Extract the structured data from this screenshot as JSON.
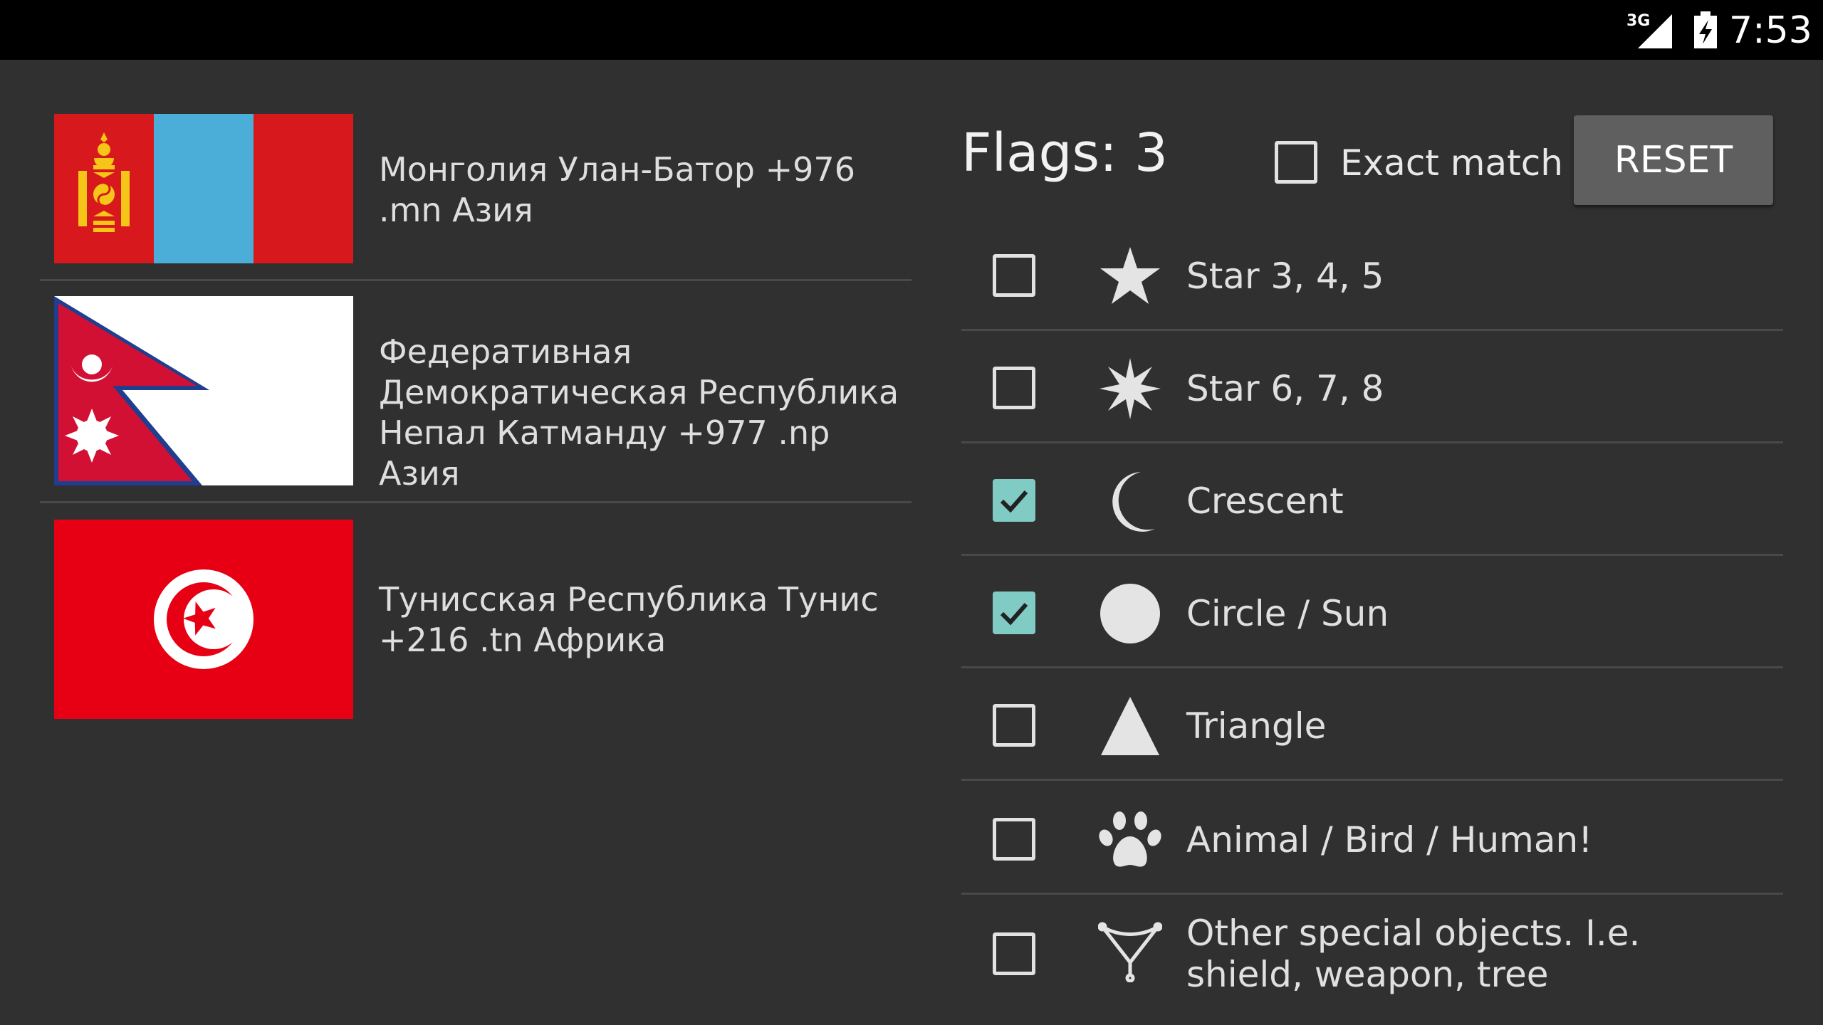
{
  "status_bar": {
    "network": "3G",
    "time": "7:53"
  },
  "flags": [
    {
      "country": "Монголия Улан-Батор +976 .mn Азия",
      "flag_icon": "mongolia-flag"
    },
    {
      "country": "Федеративная Демократическая Республика Непал Катманду +977 .np Азия",
      "flag_icon": "nepal-flag"
    },
    {
      "country": "Тунисская Республика Тунис +216 .tn Африка",
      "flag_icon": "tunisia-flag"
    }
  ],
  "filter": {
    "count_label": "Flags:",
    "count": "3",
    "exact_match_label": "Exact match",
    "exact_match_checked": false,
    "reset_label": "RESET",
    "accent_color": "#80cbc4",
    "options": [
      {
        "label": "Star 3, 4, 5",
        "icon": "star-icon",
        "checked": false
      },
      {
        "label": "Star 6, 7, 8",
        "icon": "star-burst-icon",
        "checked": false
      },
      {
        "label": "Crescent",
        "icon": "crescent-icon",
        "checked": true
      },
      {
        "label": "Circle / Sun",
        "icon": "circle-icon",
        "checked": true
      },
      {
        "label": "Triangle",
        "icon": "triangle-icon",
        "checked": false
      },
      {
        "label": "Animal / Bird / Human!",
        "icon": "paw-icon",
        "checked": false
      },
      {
        "label": "Other special objects. I.e. shield, weapon, tree",
        "icon": "special-object-icon",
        "checked": false
      }
    ]
  }
}
